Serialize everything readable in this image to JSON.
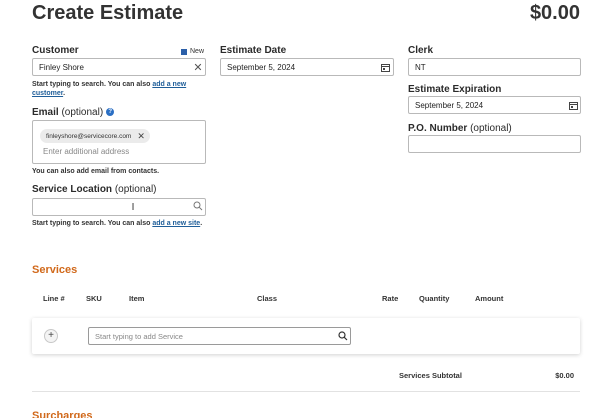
{
  "header": {
    "title": "Create Estimate",
    "total": "$0.00"
  },
  "customer": {
    "label": "Customer",
    "new_label": "New",
    "value": "Finley Shore",
    "help_prefix": "Start typing to search. You can also ",
    "help_link": "add a new customer",
    "help_suffix": "."
  },
  "email": {
    "label": "Email",
    "optional": "(optional)",
    "chip": "finleyshore@servicecore.com",
    "placeholder": "Enter additional address",
    "help": "You can also add email from contacts."
  },
  "service_location": {
    "label": "Service Location",
    "optional": "(optional)",
    "value": "",
    "help_prefix": "Start typing to search. You can also ",
    "help_link": "add a new site",
    "help_suffix": "."
  },
  "estimate_date": {
    "label": "Estimate Date",
    "value": "September 5, 2024"
  },
  "clerk": {
    "label": "Clerk",
    "value": "NT"
  },
  "estimate_expiration": {
    "label": "Estimate Expiration",
    "value": "September 5, 2024"
  },
  "po_number": {
    "label": "P.O. Number",
    "optional": "(optional)",
    "value": ""
  },
  "services": {
    "title": "Services",
    "columns": {
      "line": "Line #",
      "sku": "SKU",
      "item": "Item",
      "class": "Class",
      "rate": "Rate",
      "quantity": "Quantity",
      "amount": "Amount"
    },
    "add_placeholder": "Start typing to add Service",
    "subtotal_label": "Services Subtotal",
    "subtotal_value": "$0.00"
  },
  "surcharges": {
    "title": "Surcharges"
  },
  "colors": {
    "section_title": "#d1691b",
    "link": "#1f5e99",
    "badge": "#2b5fa8"
  },
  "icons": {
    "clear": "close-icon",
    "calendar": "calendar-icon",
    "search": "search-icon",
    "add": "plus-icon",
    "info": "info-icon"
  }
}
